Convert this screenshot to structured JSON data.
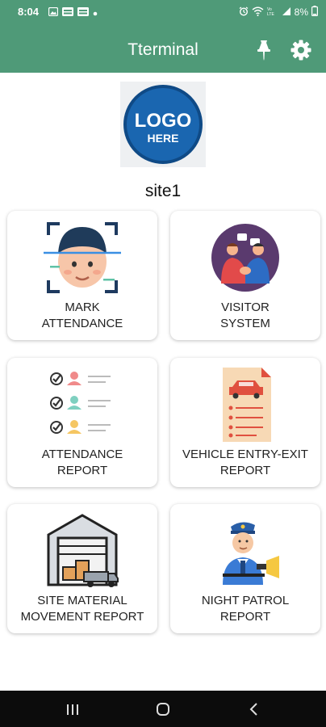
{
  "status_bar": {
    "time": "8:04",
    "battery": "8%",
    "left_icons": [
      "image-icon",
      "media-icon",
      "media-icon",
      "dot-icon"
    ],
    "right_icons": [
      "alarm-icon",
      "wifi-icon",
      "lte-icon",
      "signal-icon",
      "battery-icon"
    ]
  },
  "app_bar": {
    "title": "Tterminal",
    "color": "#4f9a78",
    "actions": [
      "pin-icon",
      "gear-icon"
    ]
  },
  "logo": {
    "line1": "LOGO",
    "line2": "HERE"
  },
  "site": "site1",
  "tiles": [
    {
      "line1": "MARK",
      "line2": "ATTENDANCE",
      "icon": "face-scan-icon"
    },
    {
      "line1": "VISITOR",
      "line2": "SYSTEM",
      "icon": "visitor-meeting-icon"
    },
    {
      "line1": "ATTENDANCE",
      "line2": "REPORT",
      "icon": "attendance-checklist-icon"
    },
    {
      "line1": "VEHICLE ENTRY-EXIT",
      "line2": "REPORT",
      "icon": "vehicle-document-icon"
    },
    {
      "line1": "SITE MATERIAL",
      "line2": "MOVEMENT REPORT",
      "icon": "warehouse-truck-icon"
    },
    {
      "line1": "NIGHT PATROL",
      "line2": "REPORT",
      "icon": "security-guard-icon"
    }
  ],
  "nav_bar": [
    "recent-apps-icon",
    "home-icon",
    "back-icon"
  ]
}
